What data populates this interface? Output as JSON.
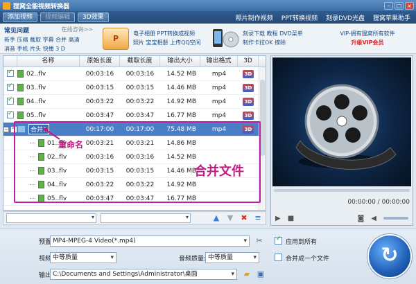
{
  "window": {
    "title": "狸窝全能视频转换器"
  },
  "menu": {
    "tabs": [
      "添加视频",
      "视频编辑",
      "3D效果"
    ],
    "links": [
      "照片制作视频",
      "PPT转换视频",
      "刻录DVD光盘",
      "狸窝苹果助手"
    ]
  },
  "ads": {
    "faq_title": "常见问题",
    "faq_online": "在线咨询>>",
    "faq_line1": "新手 压缩 截取 字幕 合并 高清",
    "faq_line2": "消音 手机 片头 快播 3 D",
    "ppt_badge": "P",
    "ad1_line1": "电子相册 PPT转换成视频",
    "ad1_line2": "照片 宝宝相册 上传QQ空间",
    "ad2_line1": "刻录下载 教程 DVD菜单",
    "ad2_line2": "制作卡拉OK 擦除",
    "vip_line1": "VIP-拥有狸窝所有软件",
    "vip_line2": "升级VIP会员"
  },
  "columns": [
    "名称",
    "原始长度",
    "截取长度",
    "输出大小",
    "输出格式",
    "3D"
  ],
  "files": [
    {
      "name": "02..flv",
      "orig": "00:03:16",
      "cut": "00:03:16",
      "size": "14.52 MB",
      "fmt": "mp4",
      "d3": "3D"
    },
    {
      "name": "03..flv",
      "orig": "00:03:15",
      "cut": "00:03:15",
      "size": "14.46 MB",
      "fmt": "mp4",
      "d3": "3D"
    },
    {
      "name": "04..flv",
      "orig": "00:03:22",
      "cut": "00:03:22",
      "size": "14.92 MB",
      "fmt": "mp4",
      "d3": "3D"
    },
    {
      "name": "05..flv",
      "orig": "00:03:47",
      "cut": "00:03:47",
      "size": "16.77 MB",
      "fmt": "mp4",
      "d3": "3D"
    }
  ],
  "group": {
    "name": "合并1",
    "orig": "00:17:00",
    "cut": "00:17:00",
    "size": "75.48 MB",
    "fmt": "mp4",
    "d3": "3D",
    "expand": "−"
  },
  "group_items": [
    {
      "name": "01..flv",
      "orig": "00:03:21",
      "cut": "00:03:21",
      "size": "14.86 MB"
    },
    {
      "name": "02..flv",
      "orig": "00:03:16",
      "cut": "00:03:16",
      "size": "14.52 MB"
    },
    {
      "name": "03..flv",
      "orig": "00:03:15",
      "cut": "00:03:15",
      "size": "14.46 MB"
    },
    {
      "name": "04..flv",
      "orig": "00:03:22",
      "cut": "00:03:22",
      "size": "14.92 MB"
    },
    {
      "name": "05..flv",
      "orig": "00:03:47",
      "cut": "00:03:47",
      "size": "16.77 MB"
    }
  ],
  "annotations": {
    "rename": "重命名",
    "merge": "合并文件"
  },
  "preview": {
    "time": "00:00:00 / 00:00:00"
  },
  "bottom": {
    "preset_label": "预置方案:",
    "preset_value": "MP4-MPEG-4 Video(*.mp4)",
    "apply_all": "应用到所有",
    "video_quality_label": "视频质量:",
    "video_quality_value": "中等质量",
    "audio_quality_label": "音频质量:",
    "audio_quality_value": "中等质量",
    "merge_label": "合并成一个文件",
    "output_label": "输出目录:",
    "output_value": "C:\\Documents and Settings\\Administrator\\桌面"
  },
  "colors": {
    "accent": "#4a7fc7",
    "annotation": "#c21a82"
  }
}
